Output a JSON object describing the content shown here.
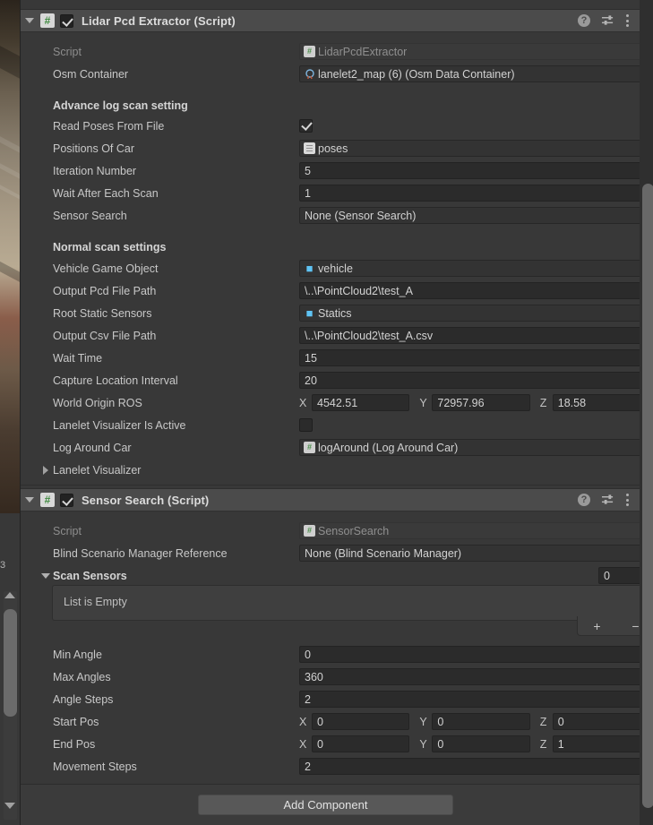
{
  "window": {
    "app": "Unity Editor",
    "panel": "Inspector"
  },
  "scene_preview": {
    "name": "scene-view-sliver"
  },
  "left_scrollbar": {
    "up_icon": "triangle-up-icon",
    "down_icon": "triangle-down-icon",
    "marker_label": "3"
  },
  "components": [
    {
      "title": "Lidar Pcd Extractor (Script)",
      "enabled": true,
      "expanded": true,
      "script_icon": "#",
      "header_icons": {
        "help": "?",
        "preset": "preset-icon",
        "menu": "kebab-menu-icon"
      },
      "rows": [
        {
          "type": "object",
          "label": "Script",
          "value": "LidarPcdExtractor",
          "icon": "script-asset-icon",
          "readonly": true
        },
        {
          "type": "object",
          "label": "Osm Container",
          "value": "lanelet2_map (6) (Osm Data Container)",
          "icon": "osm-data-icon"
        },
        {
          "type": "header",
          "label": "Advance log scan setting"
        },
        {
          "type": "checkbox",
          "label": "Read Poses From File",
          "checked": true
        },
        {
          "type": "object",
          "label": "Positions Of Car",
          "value": "poses",
          "icon": "text-asset-icon"
        },
        {
          "type": "text",
          "label": "Iteration Number",
          "value": "5"
        },
        {
          "type": "text",
          "label": "Wait After Each Scan",
          "value": "1"
        },
        {
          "type": "object",
          "label": "Sensor Search",
          "value": "None (Sensor Search)",
          "icon": "none-icon"
        },
        {
          "type": "header",
          "label": "Normal scan settings"
        },
        {
          "type": "object",
          "label": "Vehicle Game Object",
          "value": "vehicle",
          "icon": "gameobject-cube-icon"
        },
        {
          "type": "text",
          "label": "Output Pcd File Path",
          "value": "\\..\\PointCloud2\\test_A"
        },
        {
          "type": "object",
          "label": "Root Static Sensors",
          "value": "Statics",
          "icon": "gameobject-cube-icon"
        },
        {
          "type": "text",
          "label": "Output Csv File Path",
          "value": "\\..\\PointCloud2\\test_A.csv"
        },
        {
          "type": "text",
          "label": "Wait Time",
          "value": "15"
        },
        {
          "type": "text",
          "label": "Capture Location Interval",
          "value": "20"
        },
        {
          "type": "vector3",
          "label": "World Origin ROS",
          "axes": [
            "X",
            "Y",
            "Z"
          ],
          "values": [
            "4542.51",
            "72957.96",
            "18.58"
          ]
        },
        {
          "type": "checkbox",
          "label": "Lanelet Visualizer Is Active",
          "checked": false
        },
        {
          "type": "object",
          "label": "Log Around Car",
          "value": "logAround (Log Around Car)",
          "icon": "script-asset-icon"
        },
        {
          "type": "foldout",
          "label": "Lanelet Visualizer",
          "expanded": false
        }
      ]
    },
    {
      "title": "Sensor Search (Script)",
      "enabled": true,
      "expanded": true,
      "script_icon": "#",
      "header_icons": {
        "help": "?",
        "preset": "preset-icon",
        "menu": "kebab-menu-icon"
      },
      "rows": [
        {
          "type": "object",
          "label": "Script",
          "value": "SensorSearch",
          "icon": "script-asset-icon",
          "readonly": true
        },
        {
          "type": "object",
          "label": "Blind Scenario Manager Reference",
          "value": "None (Blind Scenario Manager)",
          "icon": "none-icon"
        },
        {
          "type": "list",
          "label": "Scan Sensors",
          "size": "0",
          "empty_text": "List is Empty",
          "add_label": "+",
          "remove_label": "−"
        },
        {
          "type": "text",
          "label": "Min Angle",
          "value": "0"
        },
        {
          "type": "text",
          "label": "Max Angles",
          "value": "360"
        },
        {
          "type": "text",
          "label": "Angle Steps",
          "value": "2"
        },
        {
          "type": "vector3",
          "label": "Start Pos",
          "axes": [
            "X",
            "Y",
            "Z"
          ],
          "values": [
            "0",
            "0",
            "0"
          ]
        },
        {
          "type": "vector3",
          "label": "End Pos",
          "axes": [
            "X",
            "Y",
            "Z"
          ],
          "values": [
            "0",
            "0",
            "1"
          ]
        },
        {
          "type": "text",
          "label": "Movement Steps",
          "value": "2"
        }
      ]
    }
  ],
  "footer": {
    "add_component_label": "Add Component"
  },
  "colors": {
    "panel_bg": "#383838",
    "header_bg": "#4b4b4b",
    "field_bg": "#2b2b2b",
    "object_field_bg": "#333333",
    "text": "#c8c8c8",
    "accent_cube": "#5fc4f5",
    "script_green": "#4c8f4c"
  }
}
